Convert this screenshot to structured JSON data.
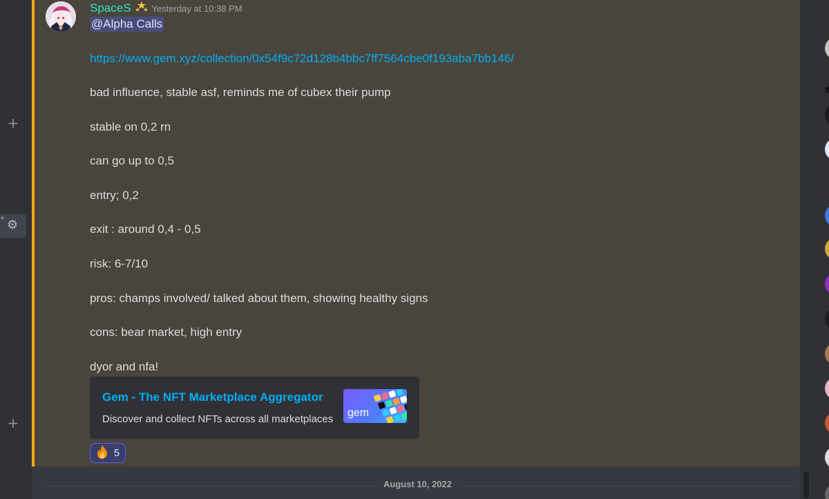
{
  "message": {
    "username": "SpaceS",
    "badge_icon": "sparkle-stars-icon",
    "timestamp": "Yesterday at 10:38 PM",
    "mention": "@Alpha Calls",
    "link": "https://www.gem.xyz/collection/0x54f9c72d128b4bbc7ff7564cbe0f193aba7bb146/",
    "lines": [
      "bad influence, stable asf, reminds me of cubex their pump",
      "stable on 0,2 rn",
      "can go up to 0,5",
      "entry; 0,2",
      "exit : around 0,4 - 0,5",
      "risk: 6-7/10",
      "pros: champs involved/ talked about them, showing healthy signs",
      "cons: bear market, high entry",
      "dyor and nfa!"
    ]
  },
  "embed": {
    "title": "Gem - The NFT Marketplace Aggregator",
    "description": "Discover and collect NFTs across all marketplaces",
    "thumbnail_word": "gem"
  },
  "reaction": {
    "emoji": "🔥",
    "count": "5"
  },
  "divider": {
    "date": "August 10, 2022"
  },
  "sidebar": {
    "add_label": "+",
    "settings_icon": "gear-icon",
    "add_icon": "plus-icon"
  },
  "colors": {
    "accent_mention_bar": "#faa81a",
    "username": "#2ee6c1",
    "link": "#00aff4",
    "highlight_bg": "#49443c"
  }
}
